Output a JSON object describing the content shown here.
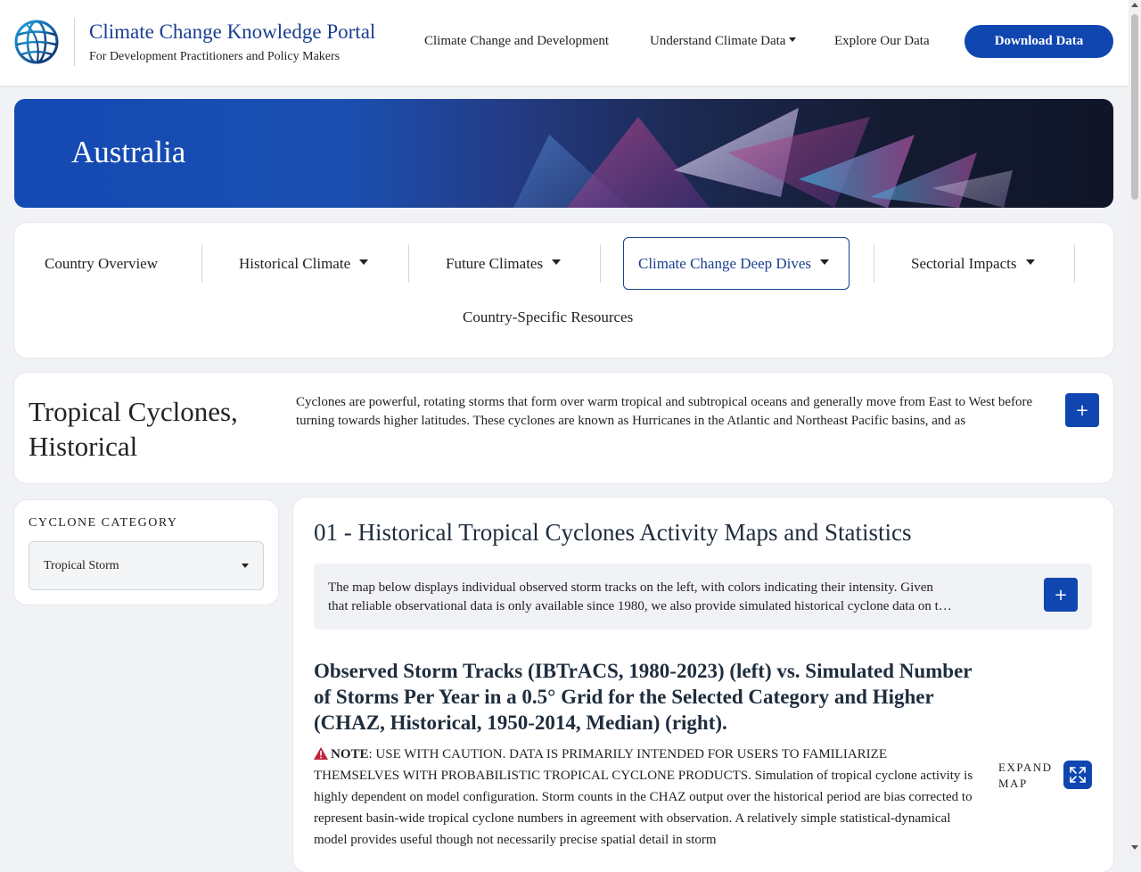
{
  "header": {
    "title": "Climate Change Knowledge Portal",
    "subtitle": "For Development Practitioners and Policy Makers",
    "nav": [
      {
        "label": "Climate Change and Development"
      },
      {
        "label": "Understand Climate Data"
      },
      {
        "label": "Explore Our Data"
      }
    ],
    "download_label": "Download Data"
  },
  "hero": {
    "country": "Australia"
  },
  "tabs": [
    {
      "label": "Country Overview"
    },
    {
      "label": "Historical Climate"
    },
    {
      "label": "Future Climates"
    },
    {
      "label": "Climate Change Deep Dives"
    },
    {
      "label": "Sectorial Impacts"
    },
    {
      "label": "Country-Specific Resources"
    }
  ],
  "intro": {
    "title": "Tropical Cyclones, Historical",
    "text": "Cyclones are powerful, rotating storms that form over warm tropical and subtropical oceans and generally move from East to West before turning towards higher latitudes. These cyclones are known as Hurricanes in the Atlantic and Northeast Pacific basins, and as",
    "expand_symbol": "+"
  },
  "sidebar": {
    "label": "CYCLONE CATEGORY",
    "selected": "Tropical Storm"
  },
  "main": {
    "title": "01 - Historical Tropical Cyclones Activity Maps and Statistics",
    "info_line1": "The map below displays individual observed storm tracks on the left, with colors indicating their intensity. Given",
    "info_line2": "that reliable observational data is only available since 1980, we also provide simulated historical cyclone data on t…",
    "info_expand_symbol": "+",
    "subheading": "Observed Storm Tracks (IBTrACS, 1980-2023) (left) vs. Simulated Number of Storms Per Year in a 0.5° Grid for the Selected Category and Higher (CHAZ, Historical, 1950-2014, Median) (right).",
    "note_label": "NOTE",
    "note_text": ": USE WITH CAUTION. DATA IS PRIMARILY INTENDED FOR USERS TO FAMILIARIZE THEMSELVES WITH PROBABILISTIC TROPICAL CYCLONE PRODUCTS. Simulation of tropical cyclone activity is highly dependent on model configuration. Storm counts in the CHAZ output over the historical period are bias corrected to represent basin-wide tropical cyclone numbers in agreement with observation. A relatively simple statistical-dynamical model provides useful though not necessarily precise spatial detail in storm",
    "expand_map_label": "EXPAND MAP"
  },
  "colors": {
    "primary": "#1046b0",
    "title_blue": "#1a3e91",
    "warning": "#c0243c"
  }
}
